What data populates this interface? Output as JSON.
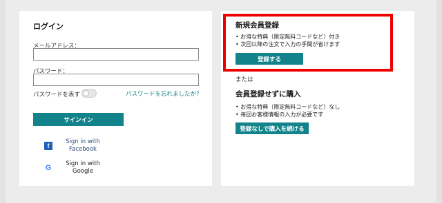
{
  "login": {
    "title": "ログイン",
    "email_label": "メールアドレス：",
    "email_value": "",
    "password_label": "パスワード：",
    "password_value": "",
    "show_password_label": "パスワードを表す",
    "show_password_on": false,
    "forgot_link": "パスワードを忘れましたか?",
    "signin_button": "サインイン",
    "social": [
      {
        "provider_icon": "facebook-icon",
        "glyph": "f",
        "label": "Sign in with Facebook"
      },
      {
        "provider_icon": "google-icon",
        "glyph": "G",
        "label": "Sign in with Google"
      }
    ]
  },
  "register": {
    "title": "新規会員登録",
    "benefits": [
      "お得な特典（限定無料コードなど）付き",
      "次回以降の注文で入力の手間が省けます"
    ],
    "button": "登録する",
    "highlight_color": "#ee0000"
  },
  "or_text": "または",
  "guest": {
    "title": "会員登録せずに購入",
    "notes": [
      "お得な特典（限定無料コードなど）なし",
      "毎回お客様情報の入力が必要です"
    ],
    "button": "登録なしで購入を続ける"
  },
  "colors": {
    "accent": "#12838b",
    "link": "#1b7f86",
    "highlight": "#ee0000"
  }
}
